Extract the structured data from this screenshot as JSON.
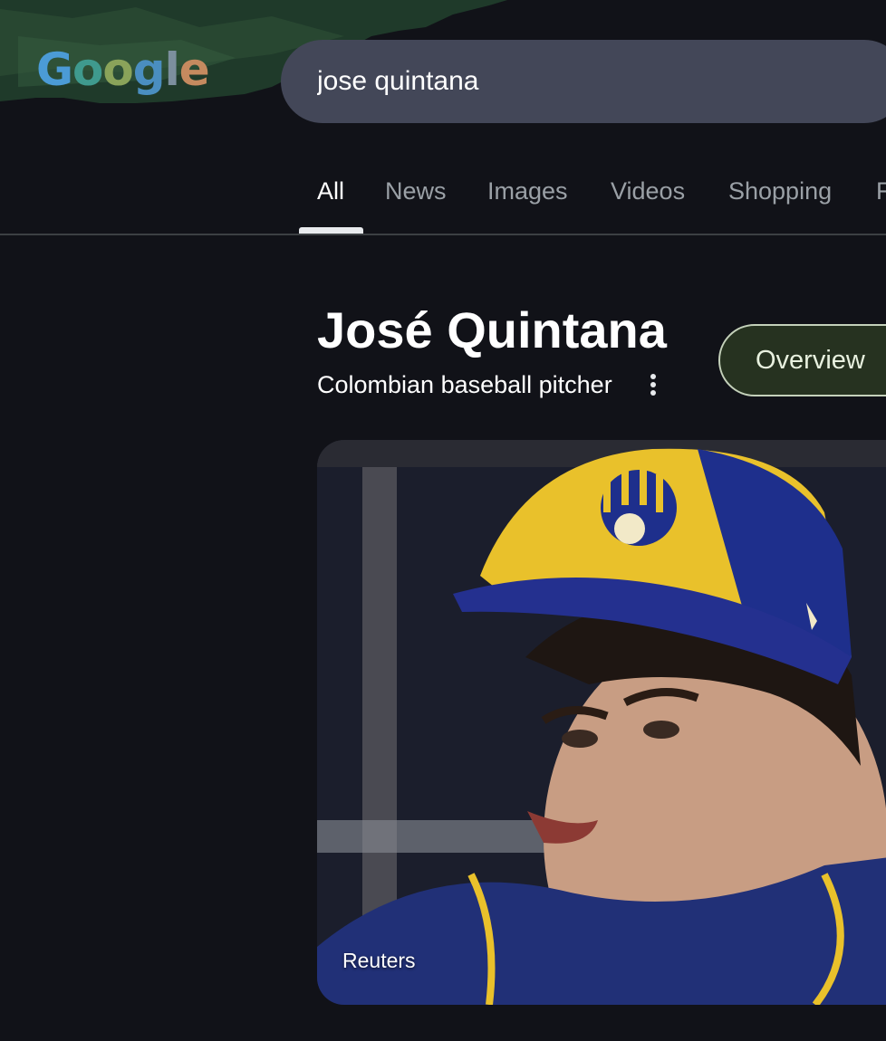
{
  "header": {
    "logo_text": "Google",
    "logo_letters": [
      "G",
      "o",
      "o",
      "g",
      "l",
      "e"
    ],
    "search_value": "jose quintana"
  },
  "tabs": [
    {
      "label": "All",
      "active": true
    },
    {
      "label": "News",
      "active": false
    },
    {
      "label": "Images",
      "active": false
    },
    {
      "label": "Videos",
      "active": false
    },
    {
      "label": "Shopping",
      "active": false
    },
    {
      "label": "F",
      "active": false
    }
  ],
  "knowledge_panel": {
    "title": "José Quintana",
    "subtitle": "Colombian baseball pitcher",
    "more_icon": "more-vert-icon",
    "overview_chip": "Overview",
    "image_source": "Reuters"
  },
  "colors": {
    "background": "#111218",
    "search_box": "#434758",
    "chip_bg": "#263220"
  }
}
